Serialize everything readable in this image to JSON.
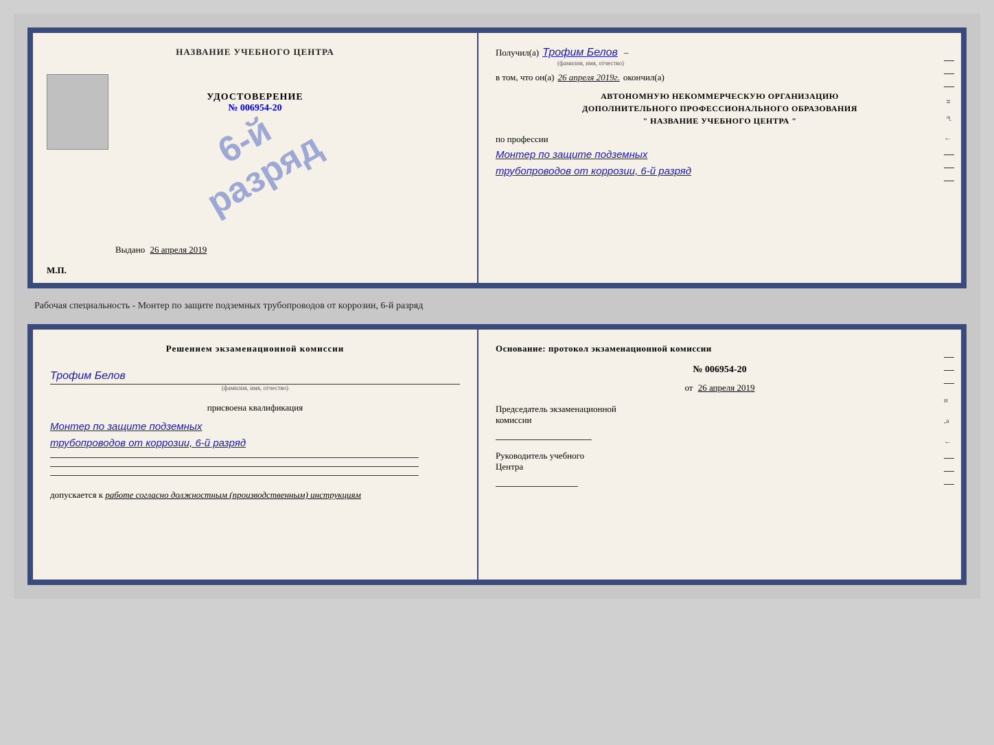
{
  "top_cert": {
    "left": {
      "title": "НАЗВАНИЕ УЧЕБНОГО ЦЕНТРА",
      "stamp_line1": "6-й",
      "stamp_line2": "разряд",
      "udostoverenie_title": "УДОСТОВЕРЕНИЕ",
      "number": "№ 006954-20",
      "vydano_label": "Выдано",
      "vydano_date": "26 апреля 2019",
      "mp_label": "М.П."
    },
    "right": {
      "poluchil": "Получил(a)",
      "name": "Трофим Белов",
      "fio_label": "(фамилия, имя, отчество)",
      "dash": "–",
      "vtom_prefix": "в том, что он(а)",
      "vtom_date": "26 апреля 2019г.",
      "okonchil": "окончил(а)",
      "org_line1": "АВТОНОМНУЮ НЕКОММЕРЧЕСКУЮ ОРГАНИЗАЦИЮ",
      "org_line2": "ДОПОЛНИТЕЛЬНОГО ПРОФЕССИОНАЛЬНОГО ОБРАЗОВАНИЯ",
      "org_line3": "\"  НАЗВАНИЕ УЧЕБНОГО ЦЕНТРА  \"",
      "po_professii": "по профессии",
      "profession_line1": "Монтер по защите подземных",
      "profession_line2": "трубопроводов от коррозии, 6-й разряд"
    }
  },
  "middle": {
    "text": "Рабочая специальность - Монтер по защите подземных трубопроводов от коррозии, 6-й разряд"
  },
  "bottom_cert": {
    "left": {
      "resheniem": "Решением экзаменационной комиссии",
      "fio": "Трофим Белов",
      "fio_label": "(фамилия, имя, отчество)",
      "prisvoena": "присвоена квалификация",
      "qualification_line1": "Монтер по защите подземных",
      "qualification_line2": "трубопроводов от коррозии, 6-й разряд",
      "dopuskaetsya": "допускается к",
      "dopuskaetsya_value": "работе согласно должностным (производственным) инструкциям"
    },
    "right": {
      "osnovanie": "Основание: протокол экзаменационной комиссии",
      "number": "№  006954-20",
      "ot_label": "от",
      "ot_date": "26 апреля 2019",
      "predsedatel_line1": "Председатель экзаменационной",
      "predsedatel_line2": "комиссии",
      "rukovoditel_line1": "Руководитель учебного",
      "rukovoditel_line2": "Центра"
    }
  }
}
